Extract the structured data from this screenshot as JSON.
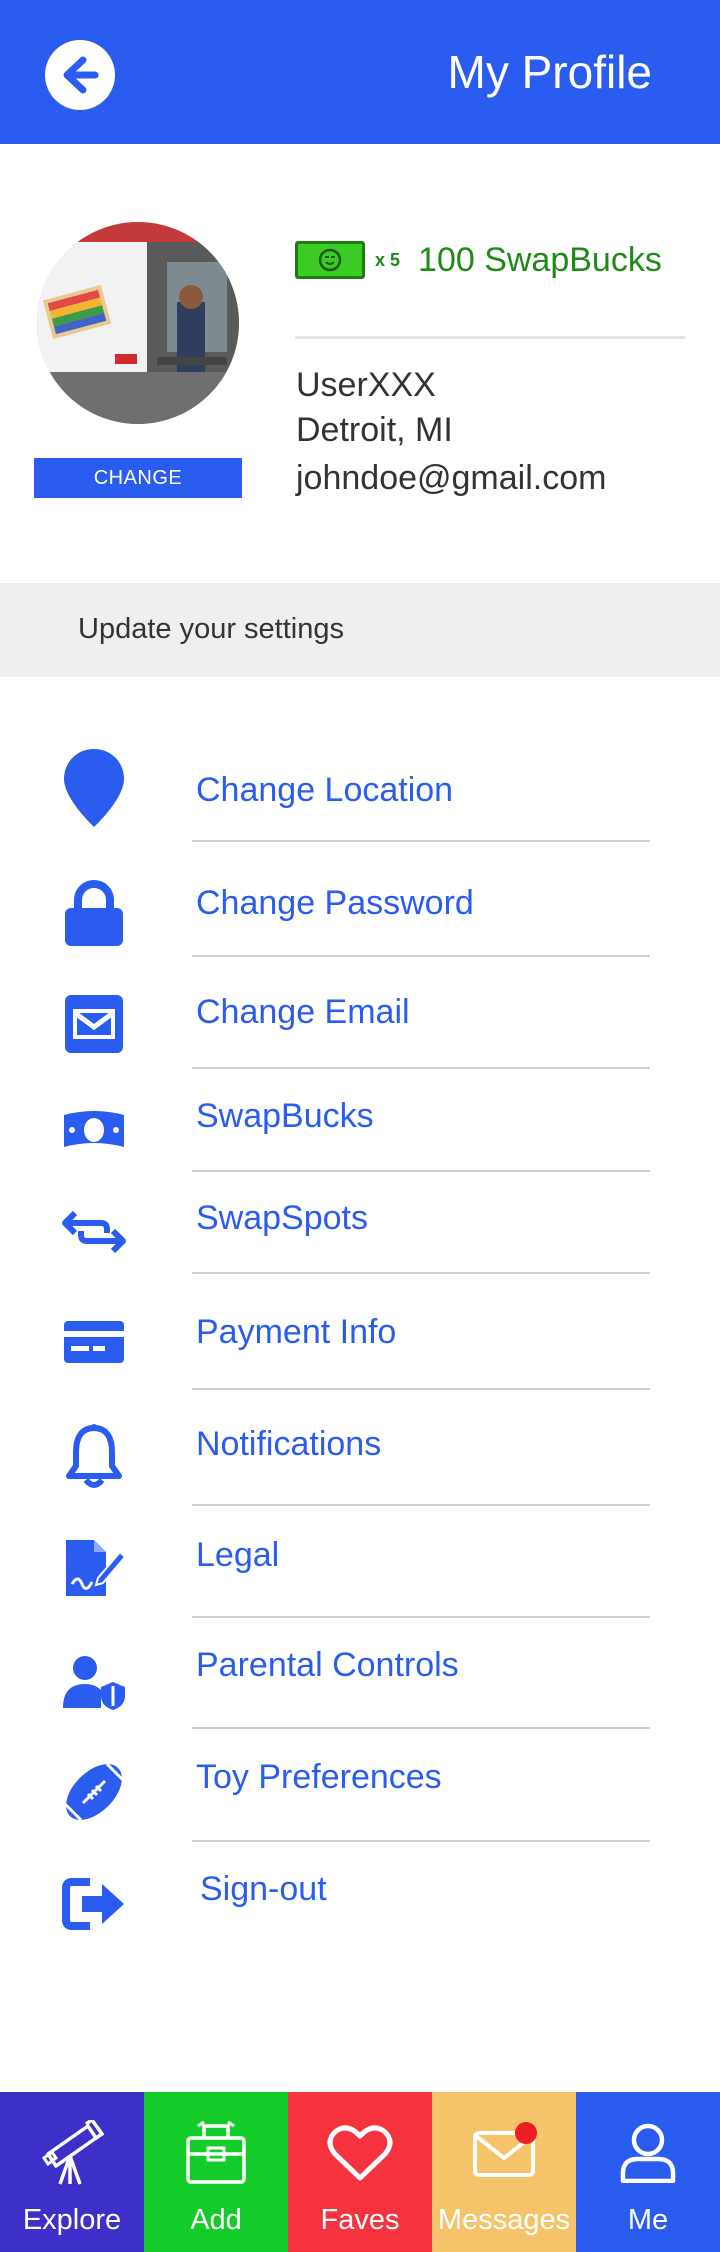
{
  "header": {
    "title": "My Profile"
  },
  "profile": {
    "change_label": "CHANGE",
    "bill_multiplier": "x 5",
    "swapbucks": "100 SwapBucks",
    "username": "UserXXX",
    "location": "Detroit, MI",
    "email": "johndoe@gmail.com"
  },
  "settings": {
    "title": "Update your settings",
    "items": [
      {
        "label": "Change Location",
        "icon": "map-pin-icon"
      },
      {
        "label": "Change Password",
        "icon": "lock-icon"
      },
      {
        "label": "Change Email",
        "icon": "envelope-icon"
      },
      {
        "label": "SwapBucks",
        "icon": "money-bill-icon"
      },
      {
        "label": "SwapSpots",
        "icon": "swap-arrows-icon"
      },
      {
        "label": "Payment Info",
        "icon": "credit-card-icon"
      },
      {
        "label": "Notifications",
        "icon": "bell-icon"
      },
      {
        "label": "Legal",
        "icon": "signed-document-icon"
      },
      {
        "label": "Parental Controls",
        "icon": "user-shield-icon"
      },
      {
        "label": "Toy Preferences",
        "icon": "football-icon"
      },
      {
        "label": "Sign-out",
        "icon": "sign-out-icon"
      }
    ]
  },
  "nav": {
    "tabs": [
      {
        "label": "Explore",
        "color": "#3d30c8",
        "icon": "telescope-icon"
      },
      {
        "label": "Add",
        "color": "#13cc2a",
        "icon": "toy-chest-icon"
      },
      {
        "label": "Faves",
        "color": "#f5333e",
        "icon": "heart-icon"
      },
      {
        "label": "Messages",
        "color": "#f5c46a",
        "icon": "envelope-icon"
      },
      {
        "label": "Me",
        "color": "#2a5cf0",
        "icon": "person-icon"
      }
    ]
  },
  "colors": {
    "primary": "#2a5cf0",
    "swapbucks_green": "#1f8a17",
    "notification_dot": "#ee1c24"
  }
}
